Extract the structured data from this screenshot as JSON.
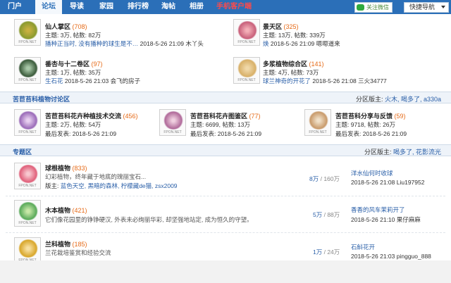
{
  "nav": {
    "items": [
      "门户",
      "论坛",
      "导读",
      "家园",
      "排行榜",
      "淘帖",
      "相册",
      "手机客户端"
    ],
    "wechat": "关注微信",
    "quicknav": "快捷导航"
  },
  "top_forums": [
    {
      "name": "仙人掌区",
      "count": "(708)",
      "stats": "主题: 3万, 帖数: 82万",
      "last_link": "播种正当时, 没有播种的球生是不…",
      "last_meta": "2018-5-26 21:09 木丫头",
      "color": "#8a9a2e"
    },
    {
      "name": "景天区",
      "count": "(325)",
      "stats": "主题: 13万, 帖数: 339万",
      "last_link": "焕",
      "last_meta": "2018-5-26 21:09 嗯嗯道来",
      "color": "#c8607a"
    },
    {
      "name": "番杏与十二卷区",
      "count": "(97)",
      "stats": "主题: 1万, 帖数: 35万",
      "last_link": "生石花",
      "last_meta": "2018-5-26 21:03 会飞的房子",
      "color": "#6b8f6a"
    },
    {
      "name": "多浆植物综合区",
      "count": "(141)",
      "stats": "主题: 4万, 帖数: 73万",
      "last_link": "球兰神奇的开花了",
      "last_meta": "2018-5-26 21:08 三火34777",
      "color": "#d8b068"
    }
  ],
  "section1": {
    "title": "苦苣苔科植物讨论区",
    "mod_label": "分区版主:",
    "mods": "火木, 喝多了, a330a"
  },
  "gesneriad_forums": [
    {
      "name": "苦苣苔科花卉种植技术交流",
      "count": "(456)",
      "stats": "主题: 2万, 帖数: 54万",
      "last": "最后发表: 2018-5-26 21:09"
    },
    {
      "name": "苦苣苔科花卉图鉴区",
      "count": "(77)",
      "stats": "主题: 6699, 帖数: 13万",
      "last": "最后发表: 2018-5-26 21:09"
    },
    {
      "name": "苦苣苔科分享与反馈",
      "count": "(59)",
      "stats": "主题: 9718, 帖数: 26万",
      "last": "最后发表: 2018-5-26 21:09"
    }
  ],
  "section2": {
    "title": "专题区",
    "mod_label": "分区版主:",
    "mods": "喝多了, 花影流光"
  },
  "topic_forums": [
    {
      "name": "球根植物",
      "count": "(833)",
      "desc": "幻彩植物，终年藏于地底的瑰丽宝石...",
      "mods_label": "版主:",
      "mods": "蓝色天空, 黑暗的森林, 柠檬藏de猫, zsx2009",
      "ratio_a": "8万",
      "ratio_b": "/ 160万",
      "last_title": "洋水仙何时收球",
      "last_meta": "2018-5-26 21:08 Liu197952",
      "color": "#e0607a"
    },
    {
      "name": "木本植物",
      "count": "(421)",
      "desc": "它们像花园里的铮铮硬汉, 外表未必绚丽华彩, 却坚强地站定, 成为恒久的守望。",
      "ratio_a": "5万",
      "ratio_b": "/ 88万",
      "last_title": "香香的风车茉莉开了",
      "last_meta": "2018-5-26 21:10 果仔麻麻",
      "color": "#5aaa5a"
    },
    {
      "name": "兰科植物",
      "count": "(185)",
      "desc": "兰花栽培鉴赏和经验交流",
      "ratio_a": "1万",
      "ratio_b": "/ 24万",
      "last_title": "石斛花开",
      "last_meta": "2018-5-26 21:03 pingguo_888",
      "color": "#d8a62a"
    }
  ],
  "watermark": "FPON.NET"
}
